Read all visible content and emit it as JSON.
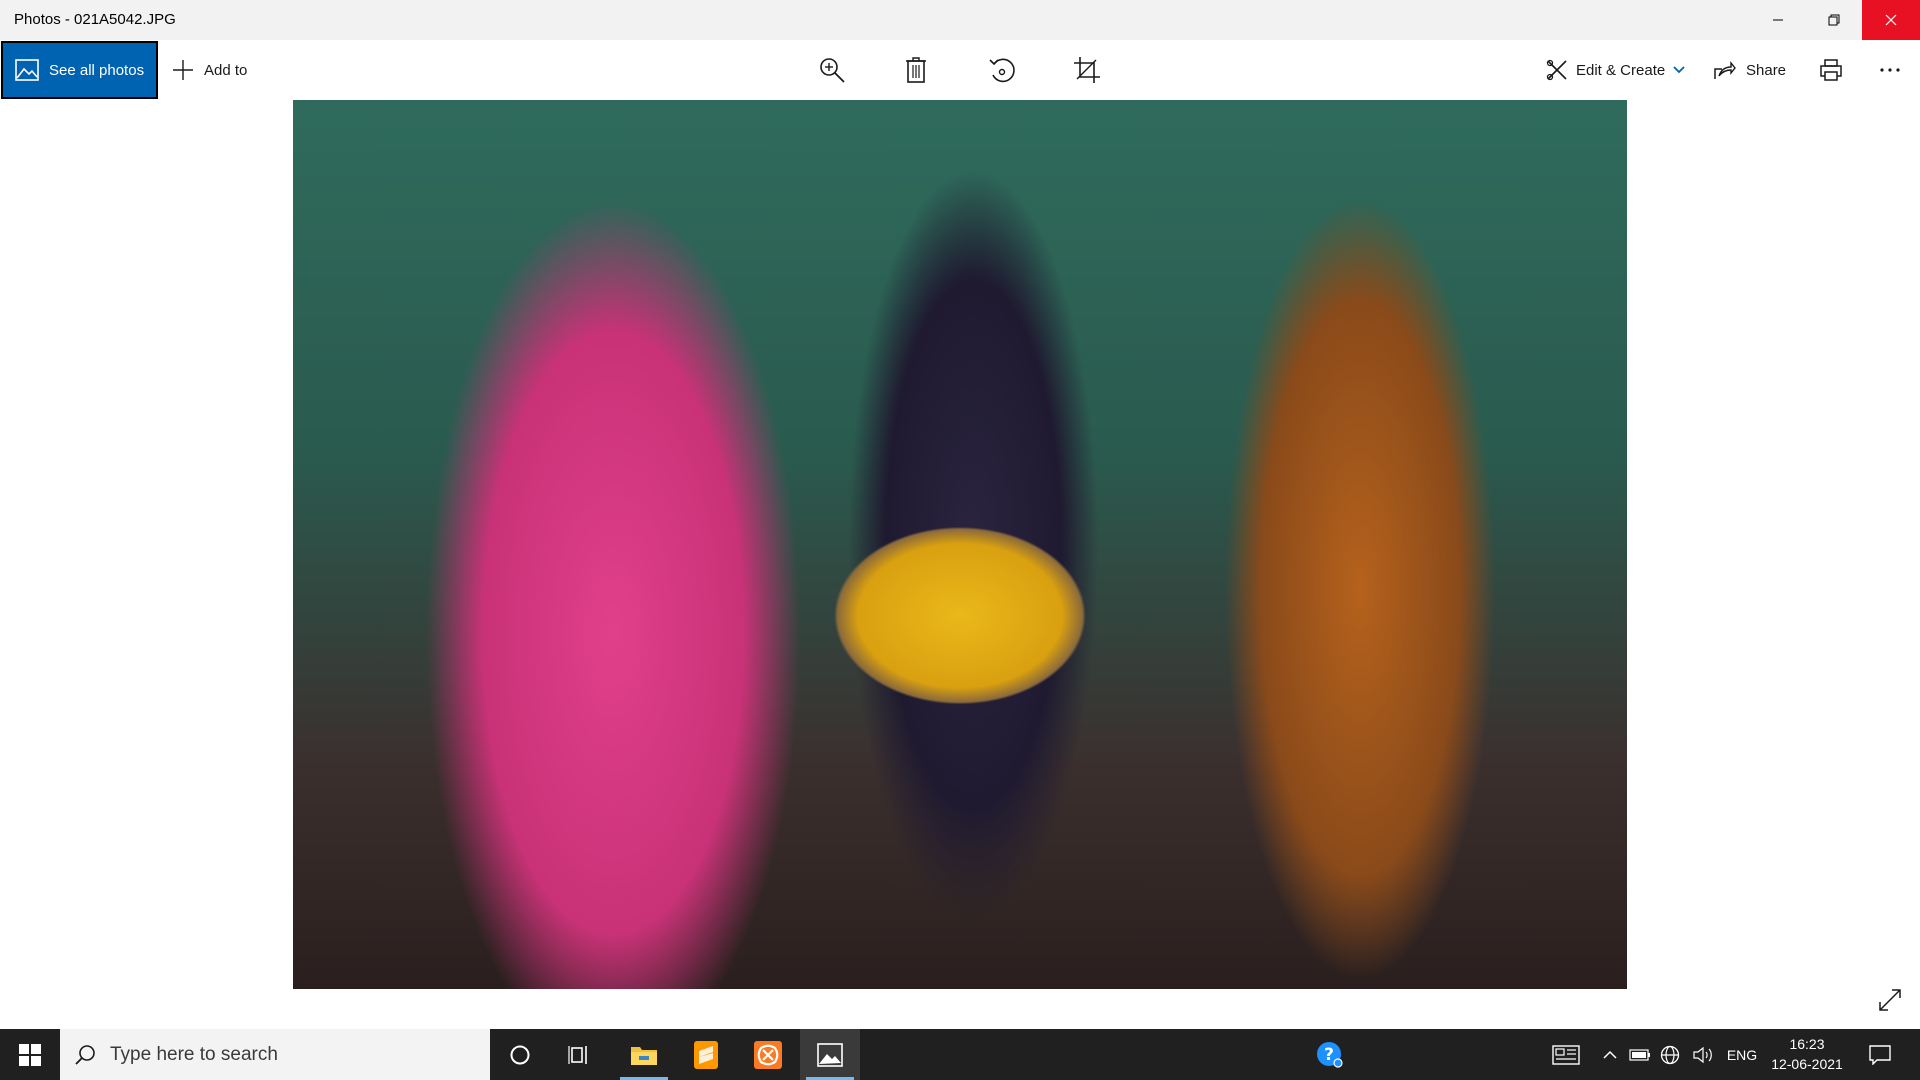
{
  "window": {
    "title": "Photos - 021A5042.JPG"
  },
  "toolbar": {
    "see_all_label": "See all photos",
    "add_to_label": "Add to",
    "edit_create_label": "Edit & Create",
    "share_label": "Share",
    "icons": [
      "zoom-icon",
      "delete-icon",
      "rotate-icon",
      "crop-icon",
      "print-icon",
      "more-icon"
    ]
  },
  "taskbar": {
    "search_placeholder": "Type here to search",
    "language": "ENG",
    "time": "16:23",
    "date": "12-06-2021",
    "apps": [
      "cortana",
      "task-view",
      "file-explorer",
      "sublime-text",
      "xampp",
      "photos"
    ]
  },
  "colors": {
    "accent": "#0063b1",
    "close": "#e81123",
    "taskbar": "#202020"
  }
}
